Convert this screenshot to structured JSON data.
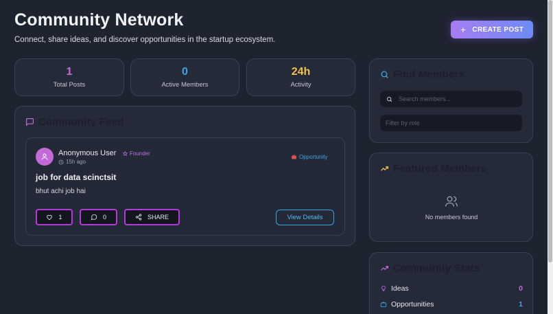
{
  "header": {
    "title": "Community Network",
    "subtitle": "Connect, share ideas, and discover opportunities in the startup ecosystem.",
    "create_post_label": "CREATE POST"
  },
  "stats": [
    {
      "value": "1",
      "label": "Total Posts",
      "color": "#c26ad8"
    },
    {
      "value": "0",
      "label": "Active Members",
      "color": "#3aa7e8"
    },
    {
      "value": "24h",
      "label": "Activity",
      "color": "#f1c24b"
    }
  ],
  "feed": {
    "title": "Community Feed",
    "post": {
      "author": "Anonymous User",
      "role_badge": "Founder",
      "time": "15h ago",
      "category": "Opportunity",
      "title": "job for data scinctsit",
      "body": "bhut achi job hai",
      "likes": "1",
      "comments": "0",
      "share_label": "SHARE",
      "view_label": "View Details"
    }
  },
  "find_members": {
    "title": "Find Members",
    "search_placeholder": "Search members...",
    "filter_placeholder": "Filter by role"
  },
  "featured": {
    "title": "Featured Members",
    "empty_text": "No members found"
  },
  "community_stats": {
    "title": "Community Stats",
    "rows": [
      {
        "label": "Ideas",
        "value": "0",
        "color": "#c26ad8"
      },
      {
        "label": "Opportunities",
        "value": "1",
        "color": "#3aa7e8"
      }
    ]
  },
  "icons": {
    "plus": "plus-icon",
    "message": "message-square-icon",
    "search": "search-icon",
    "trending": "trending-up-icon",
    "users": "users-icon",
    "user": "user-icon",
    "star": "star-icon",
    "clock": "clock-icon",
    "briefcase": "briefcase-icon",
    "heart": "heart-icon",
    "comment": "message-circle-icon",
    "share": "share-icon",
    "lightbulb": "lightbulb-icon"
  }
}
